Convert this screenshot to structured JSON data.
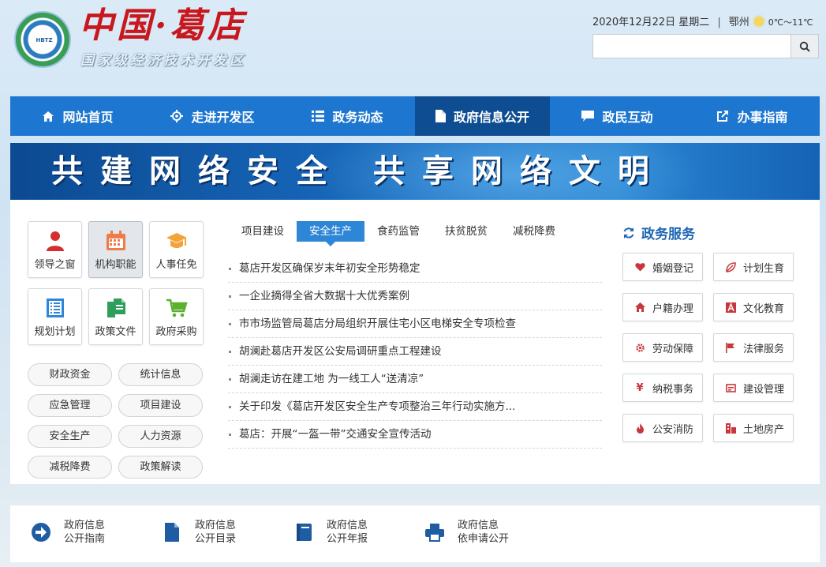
{
  "header": {
    "logo_title": "中国·葛店",
    "logo_subtitle": "国家级经济技术开发区",
    "emblem_text": "HBTZ",
    "date": "2020年12月22日 星期二",
    "separator": "|",
    "city": "鄂州",
    "temperature": "0℃～11℃",
    "search_value": ""
  },
  "nav": {
    "items": [
      {
        "label": "网站首页",
        "icon": "home-icon"
      },
      {
        "label": "走进开发区",
        "icon": "compass-icon"
      },
      {
        "label": "政务动态",
        "icon": "list-icon"
      },
      {
        "label": "政府信息公开",
        "icon": "file-icon",
        "active": true
      },
      {
        "label": "政民互动",
        "icon": "chat-icon"
      },
      {
        "label": "办事指南",
        "icon": "share-icon"
      }
    ]
  },
  "banner": {
    "text": "共建网络安全 共享网络文明"
  },
  "left": {
    "tiles": [
      {
        "label": "领导之窗",
        "icon": "person-icon"
      },
      {
        "label": "机构职能",
        "icon": "calendar-icon"
      },
      {
        "label": "人事任免",
        "icon": "graduation-cap-icon"
      },
      {
        "label": "规划计划",
        "icon": "list-doc-icon"
      },
      {
        "label": "政策文件",
        "icon": "documents-icon"
      },
      {
        "label": "政府采购",
        "icon": "cart-icon"
      }
    ],
    "pills": [
      "财政资金",
      "统计信息",
      "应急管理",
      "项目建设",
      "安全生产",
      "人力资源",
      "减税降费",
      "政策解读"
    ]
  },
  "center": {
    "tabs": [
      "项目建设",
      "安全生产",
      "食药监管",
      "扶贫脱贫",
      "减税降费"
    ],
    "active_tab": "安全生产",
    "news": [
      "葛店开发区确保岁末年初安全形势稳定",
      "一企业摘得全省大数据十大优秀案例",
      "市市场监管局葛店分局组织开展住宅小区电梯安全专项检查",
      "胡澜赴葛店开发区公安局调研重点工程建设",
      "胡澜走访在建工地 为一线工人“送清凉”",
      "关于印发《葛店开发区安全生产专项整治三年行动实施方...",
      "葛店：开展“一盔一带”交通安全宣传活动"
    ]
  },
  "services": {
    "title": "政务服务",
    "items": [
      {
        "label": "婚姻登记",
        "icon": "heart-icon"
      },
      {
        "label": "计划生育",
        "icon": "leaf-icon"
      },
      {
        "label": "户籍办理",
        "icon": "house-icon"
      },
      {
        "label": "文化教育",
        "icon": "font-a-icon"
      },
      {
        "label": "劳动保障",
        "icon": "gear-icon"
      },
      {
        "label": "法律服务",
        "icon": "flag-icon"
      },
      {
        "label": "纳税事务",
        "icon": "yen-icon"
      },
      {
        "label": "建设管理",
        "icon": "build-icon"
      },
      {
        "label": "公安消防",
        "icon": "fire-icon"
      },
      {
        "label": "土地房产",
        "icon": "building-icon"
      }
    ]
  },
  "bottom": {
    "items": [
      {
        "line1": "政府信息",
        "line2": "公开指南",
        "icon": "arrow-circle-icon"
      },
      {
        "line1": "政府信息",
        "line2": "公开目录",
        "icon": "file-icon"
      },
      {
        "line1": "政府信息",
        "line2": "公开年报",
        "icon": "book-icon"
      },
      {
        "line1": "政府信息",
        "line2": "依申请公开",
        "icon": "printer-icon"
      }
    ]
  },
  "colors": {
    "nav": "#1d76d0",
    "nav_active": "#0f4d93",
    "accent": "#2e86d6",
    "brand_red": "#c8171d"
  }
}
